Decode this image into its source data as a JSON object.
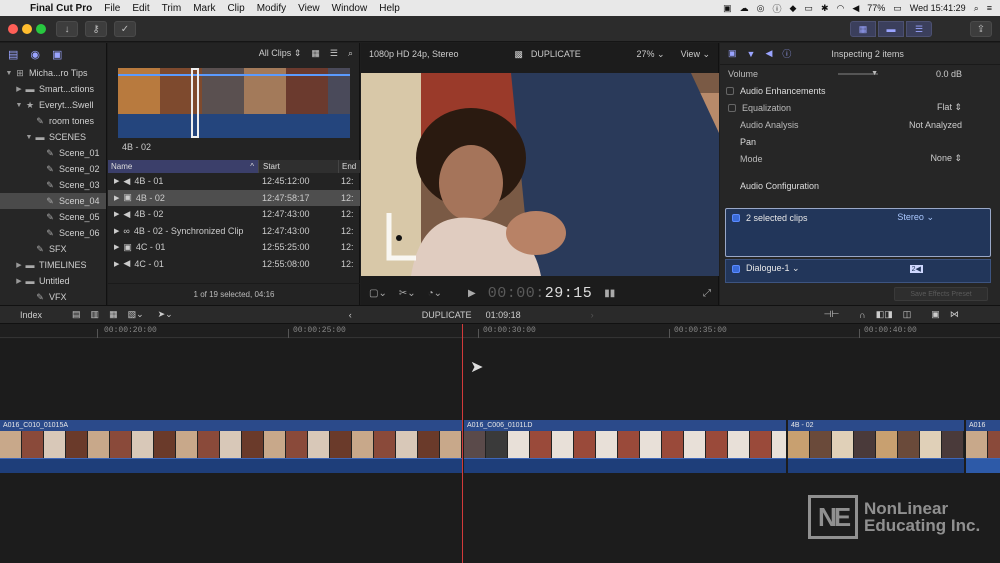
{
  "menubar": {
    "app_name": "Final Cut Pro",
    "items": [
      "File",
      "Edit",
      "Trim",
      "Mark",
      "Clip",
      "Modify",
      "View",
      "Window",
      "Help"
    ],
    "battery": "77%",
    "clock": "Wed 15:41:29"
  },
  "library": {
    "rows": [
      {
        "label": "Micha...ro Tips",
        "indent": 0,
        "tri": "▼",
        "icon": "⊞"
      },
      {
        "label": "Smart...ctions",
        "indent": 1,
        "tri": "▶",
        "icon": "▬"
      },
      {
        "label": "Everyt...Swell",
        "indent": 1,
        "tri": "▼",
        "icon": "★"
      },
      {
        "label": "room tones",
        "indent": 2,
        "tri": "",
        "icon": "✎"
      },
      {
        "label": "SCENES",
        "indent": 2,
        "tri": "▼",
        "icon": "▬"
      },
      {
        "label": "Scene_01",
        "indent": 3,
        "tri": "",
        "icon": "✎"
      },
      {
        "label": "Scene_02",
        "indent": 3,
        "tri": "",
        "icon": "✎"
      },
      {
        "label": "Scene_03",
        "indent": 3,
        "tri": "",
        "icon": "✎"
      },
      {
        "label": "Scene_04",
        "indent": 3,
        "tri": "",
        "icon": "✎",
        "selected": true
      },
      {
        "label": "Scene_05",
        "indent": 3,
        "tri": "",
        "icon": "✎"
      },
      {
        "label": "Scene_06",
        "indent": 3,
        "tri": "",
        "icon": "✎"
      },
      {
        "label": "SFX",
        "indent": 2,
        "tri": "",
        "icon": "✎"
      },
      {
        "label": "TIMELINES",
        "indent": 1,
        "tri": "▶",
        "icon": "▬"
      },
      {
        "label": "Untitled",
        "indent": 1,
        "tri": "▶",
        "icon": "▬"
      },
      {
        "label": "VFX",
        "indent": 2,
        "tri": "",
        "icon": "✎"
      }
    ]
  },
  "browser": {
    "filter": "All Clips",
    "strip_label": "4B - 02",
    "columns": [
      "Name",
      "Start",
      "End"
    ],
    "rows": [
      {
        "name": "4B - 01",
        "start": "12:45:12:00",
        "end": "12:",
        "icon": "◀"
      },
      {
        "name": "4B - 02",
        "start": "12:47:58:17",
        "end": "12:",
        "icon": "▣",
        "selected": true
      },
      {
        "name": "4B - 02",
        "start": "12:47:43:00",
        "end": "12:",
        "icon": "◀"
      },
      {
        "name": "4B - 02 - Synchronized Clip",
        "start": "12:47:43:00",
        "end": "12:",
        "icon": "∞"
      },
      {
        "name": "4C - 01",
        "start": "12:55:25:00",
        "end": "12:",
        "icon": "▣"
      },
      {
        "name": "4C - 01",
        "start": "12:55:08:00",
        "end": "12:",
        "icon": "◀"
      }
    ],
    "footer": "1 of 19 selected, 04:16"
  },
  "viewer": {
    "format": "1080p HD 24p, Stereo",
    "title": "DUPLICATE",
    "zoom": "27%",
    "view_label": "View",
    "timecode_dim": "00:00:",
    "timecode_bright": "29:15"
  },
  "inspector": {
    "title": "Inspecting 2 items",
    "volume_label": "Volume",
    "volume_value": "0.0 dB",
    "enhancements": "Audio Enhancements",
    "equalization_label": "Equalization",
    "equalization_value": "Flat",
    "analysis_label": "Audio Analysis",
    "analysis_value": "Not Analyzed",
    "pan_label": "Pan",
    "mode_label": "Mode",
    "mode_value": "None",
    "config_label": "Audio Configuration",
    "clip_group": "2 selected clips",
    "clip_group_value": "Stereo",
    "dialogue": "Dialogue-1",
    "dialogue_badge": "2◀",
    "save_preset": "Save Effects Preset"
  },
  "timeline_bar": {
    "index": "Index",
    "project": "DUPLICATE",
    "duration": "01:09:18"
  },
  "ruler": [
    "00:00:20:00",
    "00:00:25:00",
    "00:00:30:00",
    "00:00:35:00",
    "00:00:40:00"
  ],
  "clips": [
    {
      "title": "A016_C010_01015A"
    },
    {
      "title": "A016_C006_0101LD"
    },
    {
      "title": "4B - 02"
    },
    {
      "title": "A016"
    }
  ],
  "watermark": {
    "logo": "NE",
    "line1": "NonLinear",
    "line2": "Educating Inc."
  }
}
